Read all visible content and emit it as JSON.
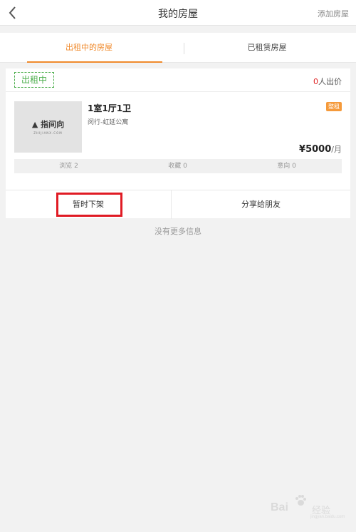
{
  "header": {
    "title": "我的房屋",
    "action_label": "添加房屋"
  },
  "tabs": [
    {
      "label": "出租中的房屋",
      "active": true
    },
    {
      "label": "已租赁房屋",
      "active": false
    }
  ],
  "listing": {
    "status_badge": "出租中",
    "bid_count": "0",
    "bid_suffix": "人出价",
    "thumbnail_logo": "指间向",
    "thumbnail_logo_sub": "ZHIJIANX.COM",
    "title": "1室1厅1卫",
    "location": "闵行-虹延公寓",
    "rent_type": "整租",
    "price": "¥5000",
    "price_unit": "/月",
    "stats": [
      {
        "label": "浏览 2"
      },
      {
        "label": "收藏 0"
      },
      {
        "label": "意向 0"
      }
    ],
    "actions": {
      "delist_label": "暂时下架",
      "share_label": "分享给朋友"
    }
  },
  "footer_text": "没有更多信息",
  "watermark": {
    "text_latin": "Bai",
    "text_cn": "经验",
    "sub": "jingyan.baidu.com"
  },
  "colors": {
    "accent": "#f08a2c",
    "status_green": "#4cae4c",
    "bid_red": "#e02020",
    "highlight_red": "#e01b24"
  }
}
